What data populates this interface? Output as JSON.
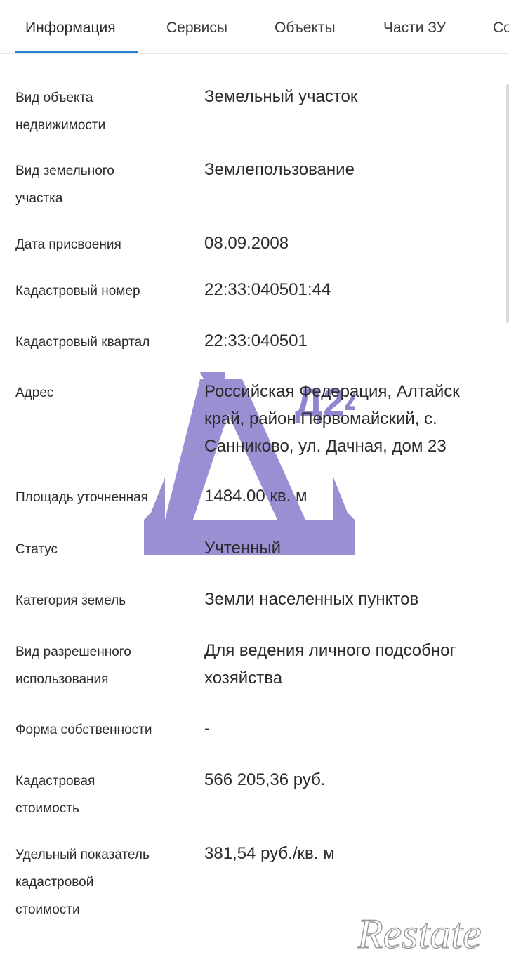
{
  "tabs": [
    {
      "label": "Информация",
      "active": true
    },
    {
      "label": "Сервисы"
    },
    {
      "label": "Объекты"
    },
    {
      "label": "Части ЗУ"
    },
    {
      "label": "Со"
    }
  ],
  "accent_color": "#2a7fd4",
  "rows": [
    {
      "label": "Вид объекта\nнедвижимости",
      "value": "Земельный участок"
    },
    {
      "label": "Вид земельного\nучастка",
      "value": "Землепользование"
    },
    {
      "label": "Дата присвоения",
      "value": "08.09.2008"
    },
    {
      "label": "Кадастровый номер",
      "value": "22:33:040501:44"
    },
    {
      "label": "Кадастровый квартал",
      "value": "22:33:040501"
    },
    {
      "label": "Адрес",
      "value": "Российская Федерация, Алтайск\nкрай, район Первомайский, с.\nСанниково, ул. Дачная, дом 23"
    },
    {
      "label": "Площадь уточненная",
      "value": "1484.00 кв. м"
    },
    {
      "label": "Статус",
      "value": "Учтенный"
    },
    {
      "label": "Категория земель",
      "value": "Земли населенных пунктов"
    },
    {
      "label": "Вид разрешенного\nиспользования",
      "value": "Для ведения личного подсобног\nхозяйства"
    },
    {
      "label": "Форма собственности",
      "value": "-"
    },
    {
      "label": "Кадастровая\nстоимость",
      "value": "566 205,36 руб."
    },
    {
      "label": "Удельный показатель\nкадастровой\nстоимости",
      "value": "381,54 руб./кв. м"
    }
  ],
  "watermarks": {
    "logo_text": "Д24",
    "logo_color": "#8070c8",
    "brand_text": "Restate"
  }
}
